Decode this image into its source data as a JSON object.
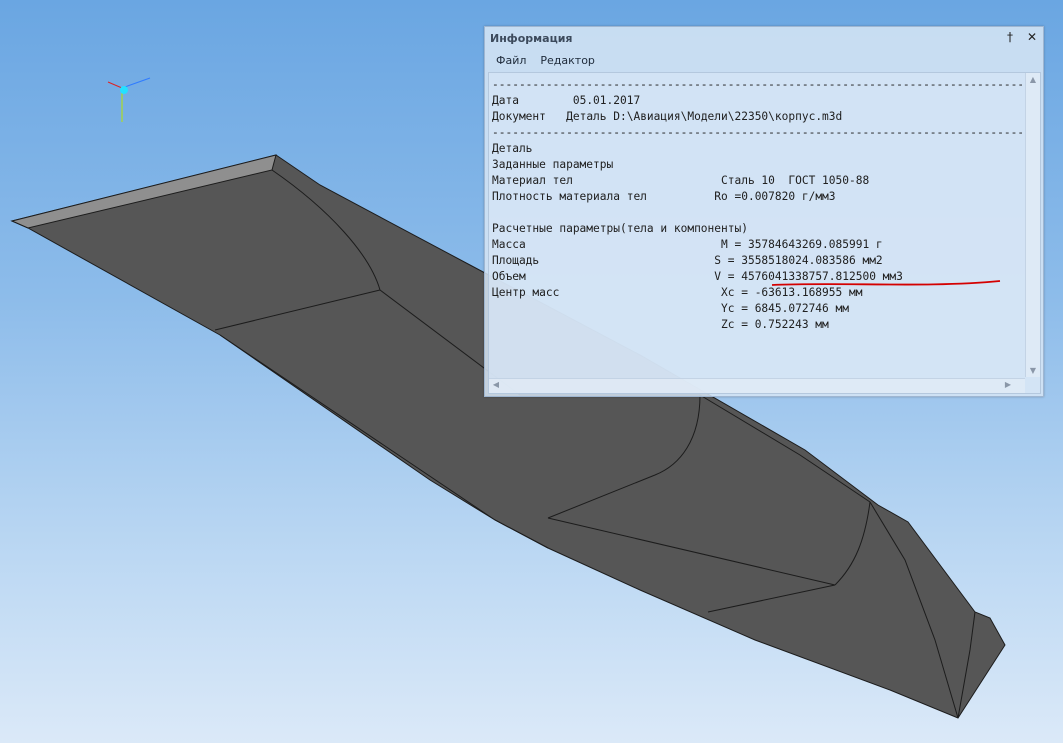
{
  "window": {
    "title": "Информация",
    "pin_symbol": "†",
    "close_symbol": "✕"
  },
  "menu": {
    "file": "Файл",
    "edit": "Редактор"
  },
  "report": {
    "separator": "-------------------------------------------------------------------------------",
    "date_label": "Дата",
    "date_value": "05.01.2017",
    "document_label": "Документ",
    "document_value": "Деталь D:\\Авиация\\Модели\\22350\\корпус.m3d",
    "part_heading": "Деталь",
    "given_params": "Заданные параметры",
    "material_label": "Материал тел",
    "material_value": "Сталь 10  ГОСТ 1050-88",
    "density_label": "Плотность материала тел",
    "density_value": "Ro =0.007820 г/мм3",
    "calc_params": "Расчетные параметры(тела и компоненты)",
    "mass_label": "Масса",
    "mass_value": "M = 35784643269.085991 г",
    "area_label": "Площадь",
    "area_value": "S = 3558518024.083586 мм2",
    "volume_label": "Объем",
    "volume_value": "V = 4576041338757.812500 мм3",
    "center_label": "Центр масс",
    "xc_value": "Xc = -63613.168955 мм",
    "yc_value": "Yc = 6845.072746 мм",
    "zc_value": "Zc = 0.752243 мм"
  },
  "colors": {
    "model_fill": "#565656",
    "model_edge": "#1c1c1c",
    "model_top_face": "#8f8f8f",
    "underline": "#d40000"
  }
}
